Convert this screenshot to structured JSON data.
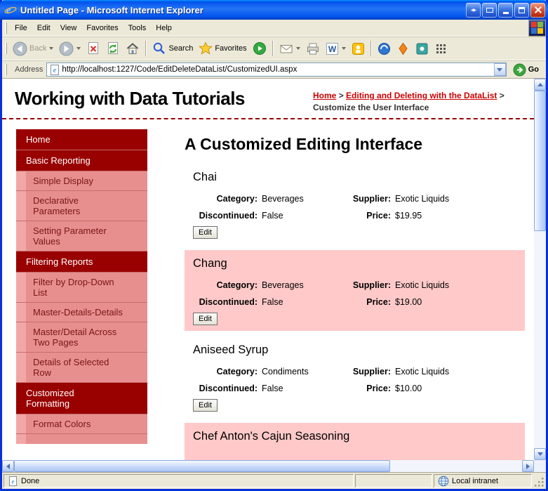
{
  "window": {
    "title": "Untitled Page - Microsoft Internet Explorer",
    "status": {
      "done": "Done",
      "zone": "Local intranet"
    }
  },
  "menu": {
    "items": [
      "File",
      "Edit",
      "View",
      "Favorites",
      "Tools",
      "Help"
    ]
  },
  "toolbar": {
    "back": "Back",
    "search": "Search",
    "favorites": "Favorites"
  },
  "address": {
    "label": "Address",
    "url": "http://localhost:1227/Code/EditDeleteDataList/CustomizedUI.aspx",
    "go": "Go"
  },
  "header": {
    "title": "Working with Data Tutorials",
    "breadcrumb": {
      "home": "Home",
      "sep": ">",
      "section": "Editing and Deleting with the DataList",
      "current": "Customize the User Interface"
    }
  },
  "sidebar": {
    "items": [
      {
        "label": "Home",
        "type": "section"
      },
      {
        "label": "Basic Reporting",
        "type": "section"
      },
      {
        "label": "Simple Display",
        "type": "sub"
      },
      {
        "label": "Declarative Parameters",
        "type": "sub"
      },
      {
        "label": "Setting Parameter Values",
        "type": "sub"
      },
      {
        "label": "Filtering Reports",
        "type": "section"
      },
      {
        "label": "Filter by Drop-Down List",
        "type": "sub"
      },
      {
        "label": "Master-Details-Details",
        "type": "sub"
      },
      {
        "label": "Master/Detail Across Two Pages",
        "type": "sub"
      },
      {
        "label": "Details of Selected Row",
        "type": "sub"
      },
      {
        "label": "Customized Formatting",
        "type": "section"
      },
      {
        "label": "Format Colors",
        "type": "sub"
      },
      {
        "label": "",
        "type": "sub-partial"
      }
    ]
  },
  "main": {
    "title": "A Customized Editing Interface",
    "labels": {
      "category": "Category:",
      "supplier": "Supplier:",
      "discontinued": "Discontinued:",
      "price": "Price:",
      "edit": "Edit"
    },
    "products": [
      {
        "name": "Chai",
        "category": "Beverages",
        "supplier": "Exotic Liquids",
        "discontinued": "False",
        "price": "$19.95",
        "highlighted": false
      },
      {
        "name": "Chang",
        "category": "Beverages",
        "supplier": "Exotic Liquids",
        "discontinued": "False",
        "price": "$19.00",
        "highlighted": true
      },
      {
        "name": "Aniseed Syrup",
        "category": "Condiments",
        "supplier": "Exotic Liquids",
        "discontinued": "False",
        "price": "$10.00",
        "highlighted": false
      },
      {
        "name": "Chef Anton's Cajun Seasoning",
        "highlighted": true
      }
    ]
  },
  "colors": {
    "titlebar_blue": "#0053EE",
    "chrome_tan": "#ECE9D8",
    "maroon": "#990000",
    "sidebar_pink": "#E78F8F",
    "highlight_pink": "#FFC9C9",
    "link_red": "#CC0000"
  }
}
